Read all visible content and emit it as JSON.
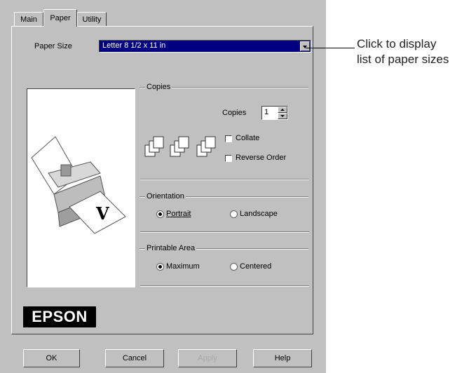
{
  "tabs": [
    {
      "label": "Main",
      "active": false
    },
    {
      "label": "Paper",
      "active": true
    },
    {
      "label": "Utility",
      "active": false
    }
  ],
  "paper_size": {
    "label": "Paper Size",
    "value": "Letter 8 1/2 x 11 in"
  },
  "copies_group": {
    "title": "Copies",
    "copies_label": "Copies",
    "copies_value": "1",
    "collate_label": "Collate",
    "collate_checked": false,
    "reverse_order_label": "Reverse Order",
    "reverse_order_checked": false
  },
  "orientation_group": {
    "title": "Orientation",
    "portrait_label": "Portrait",
    "landscape_label": "Landscape",
    "selected": "Portrait"
  },
  "printable_area_group": {
    "title": "Printable Area",
    "maximum_label": "Maximum",
    "centered_label": "Centered",
    "selected": "Maximum"
  },
  "logo": "EPSON",
  "buttons": {
    "ok": "OK",
    "cancel": "Cancel",
    "apply": "Apply",
    "help": "Help"
  },
  "callout": {
    "line1": "Click to display",
    "line2": "list of paper sizes"
  },
  "colors": {
    "dialog_bg": "#c0c0c0",
    "selection": "#000080",
    "logo_bg": "#000000"
  }
}
